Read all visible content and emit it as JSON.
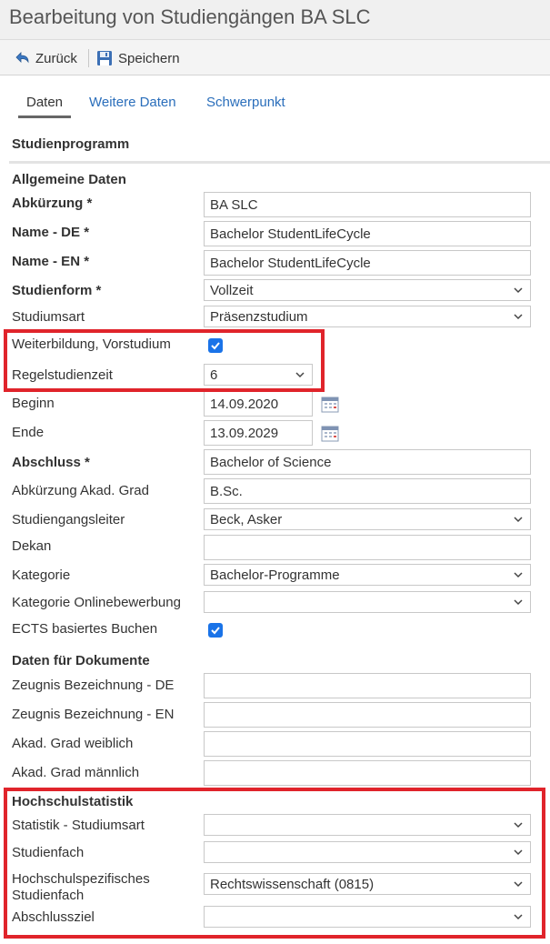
{
  "window": {
    "title": "Bearbeitung von Studiengängen BA SLC"
  },
  "toolbar": {
    "back_label": "Zurück",
    "save_label": "Speichern"
  },
  "tabs": [
    {
      "label": "Daten",
      "active": true
    },
    {
      "label": "Weitere Daten",
      "active": false
    },
    {
      "label": "Schwerpunkt",
      "active": false
    }
  ],
  "section_title": "Studienprogramm",
  "groups": {
    "general": "Allgemeine Daten",
    "documents": "Daten für Dokumente",
    "statistics": "Hochschulstatistik"
  },
  "fields": {
    "abkuerzung": {
      "label": "Abkürzung *",
      "value": "BA SLC"
    },
    "name_de": {
      "label": "Name - DE *",
      "value": "Bachelor StudentLifeCycle"
    },
    "name_en": {
      "label": "Name - EN *",
      "value": "Bachelor StudentLifeCycle"
    },
    "studienform": {
      "label": "Studienform *",
      "value": "Vollzeit"
    },
    "studiumsart": {
      "label": "Studiumsart",
      "value": "Präsenzstudium"
    },
    "weiterbildung": {
      "label": "Weiterbildung, Vorstudium",
      "checked": true
    },
    "regelstudienzeit": {
      "label": "Regelstudienzeit",
      "value": "6"
    },
    "beginn": {
      "label": "Beginn",
      "value": "14.09.2020"
    },
    "ende": {
      "label": "Ende",
      "value": "13.09.2029"
    },
    "abschluss": {
      "label": "Abschluss *",
      "value": "Bachelor of Science"
    },
    "abk_grad": {
      "label": "Abkürzung Akad. Grad",
      "value": "B.Sc."
    },
    "leiter": {
      "label": "Studiengangsleiter",
      "value": "Beck, Asker"
    },
    "dekan": {
      "label": "Dekan",
      "value": ""
    },
    "kategorie": {
      "label": "Kategorie",
      "value": "Bachelor-Programme"
    },
    "kategorie_online": {
      "label": "Kategorie Onlinebewerbung",
      "value": ""
    },
    "ects": {
      "label": "ECTS basiertes Buchen",
      "checked": true
    },
    "zeugnis_de": {
      "label": "Zeugnis Bezeichnung - DE",
      "value": ""
    },
    "zeugnis_en": {
      "label": "Zeugnis Bezeichnung - EN",
      "value": ""
    },
    "grad_weiblich": {
      "label": "Akad. Grad weiblich",
      "value": ""
    },
    "grad_maennlich": {
      "label": "Akad. Grad männlich",
      "value": ""
    },
    "stat_studiumsart": {
      "label": "Statistik - Studiumsart",
      "value": ""
    },
    "studienfach": {
      "label": "Studienfach",
      "value": ""
    },
    "hs_studienfach": {
      "label_line1": "Hochschulspezifisches",
      "label_line2": "Studienfach",
      "value": "Rechtswissenschaft (0815)"
    },
    "abschlussziel": {
      "label": "Abschlussziel",
      "value": ""
    }
  },
  "colors": {
    "accent": "#1a73e8",
    "link": "#2a6ebb",
    "highlight": "#e0242b"
  },
  "icons": {
    "back": "back-arrow-icon",
    "save": "floppy-disk-icon",
    "calendar": "calendar-icon",
    "dropdown": "chevron-down-icon"
  }
}
